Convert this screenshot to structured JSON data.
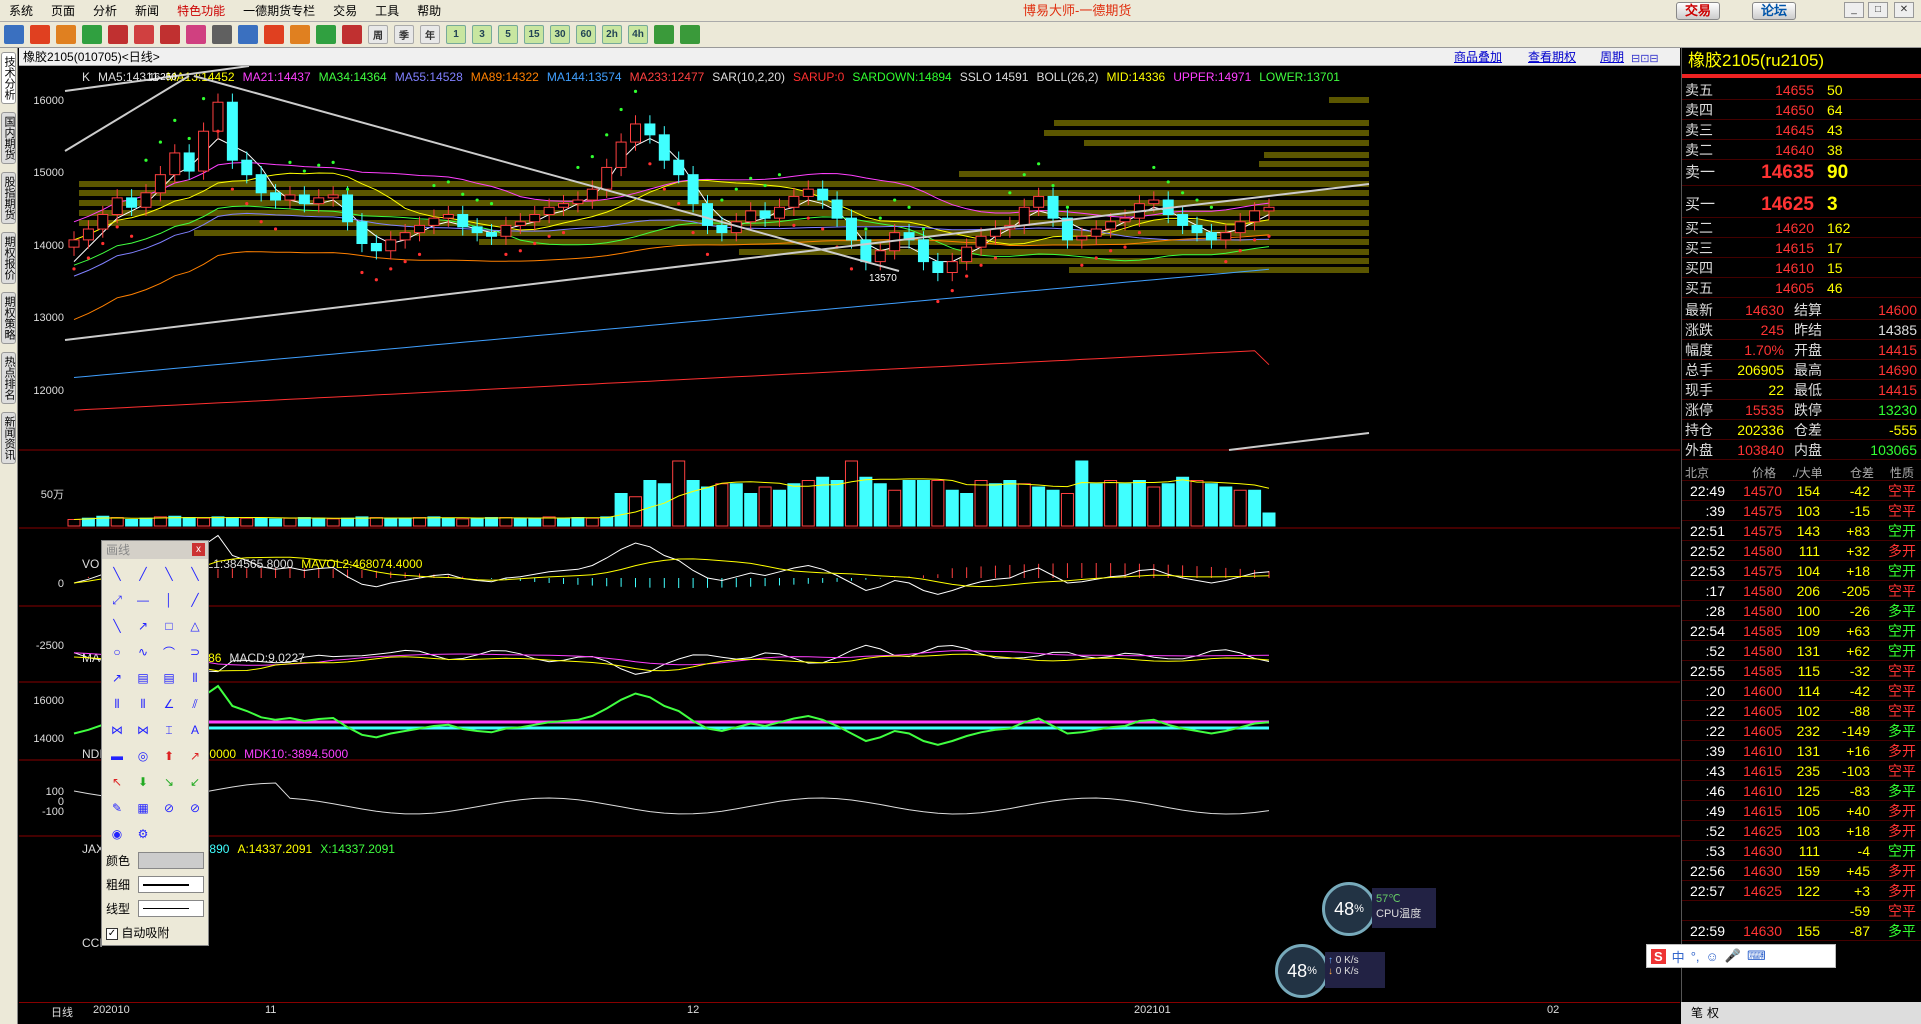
{
  "menu": {
    "items": [
      "系统",
      "页面",
      "分析",
      "新闻",
      "特色功能",
      "一德期货专栏",
      "交易",
      "工具",
      "帮助"
    ],
    "app_title": "博易大师-一德期货",
    "trade_label": "交易",
    "forum_label": "论坛"
  },
  "toolbar": {
    "text_buttons": [
      "周",
      "季",
      "年",
      "1",
      "3",
      "5",
      "15",
      "30",
      "60",
      "2h",
      "4h"
    ]
  },
  "left_tabs": [
    "技术分析",
    "国内期货",
    "股指期货",
    "期权报价",
    "期权策略",
    "热点排名",
    "新闻资讯"
  ],
  "title_bar": {
    "symbol": "橡胶2105(010705)<日线>",
    "links": [
      "商品叠加",
      "查看期权",
      "周期"
    ]
  },
  "main_chart": {
    "legend": [
      {
        "t": "K",
        "c": "#ddd"
      },
      {
        "t": "MA5:14311",
        "c": "#ddd"
      },
      {
        "t": "MA13:14452",
        "c": "#ffff00"
      },
      {
        "t": "MA21:14437",
        "c": "#ff40ff"
      },
      {
        "t": "MA34:14364",
        "c": "#40ff40"
      },
      {
        "t": "MA55:14528",
        "c": "#8080ff"
      },
      {
        "t": "MA89:14322",
        "c": "#ff8000"
      },
      {
        "t": "MA144:13574",
        "c": "#40a0ff"
      },
      {
        "t": "MA233:12477",
        "c": "#ff4040"
      },
      {
        "t": "SAR(10,2,20)",
        "c": "#ddd"
      },
      {
        "t": "SARUP:0",
        "c": "#ff3030"
      },
      {
        "t": "SARDOWN:14894",
        "c": "#30ff30"
      },
      {
        "t": "SSLO 14591",
        "c": "#ddd"
      },
      {
        "t": "BOLL(26,2)",
        "c": "#ddd"
      },
      {
        "t": "MID:14336",
        "c": "#ffff00"
      },
      {
        "t": "UPPER:14971",
        "c": "#ff40ff"
      },
      {
        "t": "LOWER:13701",
        "c": "#40ff40"
      }
    ],
    "y_ticks": [
      "16000",
      "15000",
      "14000",
      "13000",
      "12000"
    ],
    "hi_label": "16250",
    "lo_label": "13570"
  },
  "vol_panel": {
    "legend": [
      {
        "t": "VO",
        "c": "#ddd"
      },
      {
        "t": "6905.0000",
        "c": "#ddd"
      },
      {
        "t": "MAVOL1:384565.8000",
        "c": "#ddd"
      },
      {
        "t": "MAVOL2:468074.4000",
        "c": "#ffff00"
      }
    ],
    "y_tick": "50万"
  },
  "macd_panel": {
    "legend": [
      {
        "t": "MA",
        "c": "#ddd"
      },
      {
        "t": ".9772",
        "c": "#ddd"
      },
      {
        "t": "DEA:-12.4886",
        "c": "#ffff00"
      },
      {
        "t": "MACD:9.0227",
        "c": "#ddd"
      }
    ],
    "y_tick": "0"
  },
  "ndi_panel": {
    "legend": [
      {
        "t": "NDI",
        "c": "#ddd"
      },
      {
        "t": "000",
        "c": "#ddd"
      },
      {
        "t": "MDK5:-4096.0000",
        "c": "#ffff00"
      },
      {
        "t": "MDK10:-3894.5000",
        "c": "#ff40ff"
      }
    ],
    "y_tick": "-2500"
  },
  "jax_panel": {
    "legend": [
      {
        "t": "JAX",
        "c": "#ddd"
      },
      {
        "t": "1.3890",
        "c": "#ff40ff"
      },
      {
        "t": "J:14521.3890",
        "c": "#40ffff"
      },
      {
        "t": "A:14337.2091",
        "c": "#ffff00"
      },
      {
        "t": "X:14337.2091",
        "c": "#40ff40"
      }
    ],
    "y_ticks": [
      "16000",
      "14000"
    ]
  },
  "cci_panel": {
    "legend": [
      {
        "t": "CCI",
        "c": "#ddd"
      }
    ],
    "y_ticks": [
      "100",
      "0",
      "-100"
    ]
  },
  "date_axis": {
    "period": "日线",
    "labels": [
      "202010",
      "11",
      "12",
      "202101",
      "02"
    ]
  },
  "draw_panel": {
    "title": "画线",
    "close": "x",
    "color_label": "颜色",
    "width_label": "粗细",
    "style_label": "线型",
    "auto_label": "自动吸附"
  },
  "quote": {
    "name": "橡胶2105(ru2105)",
    "asks": [
      {
        "l": "卖五",
        "p": "14655",
        "v": "50"
      },
      {
        "l": "卖四",
        "p": "14650",
        "v": "64"
      },
      {
        "l": "卖三",
        "p": "14645",
        "v": "43"
      },
      {
        "l": "卖二",
        "p": "14640",
        "v": "38"
      },
      {
        "l": "卖一",
        "p": "14635",
        "v": "90"
      }
    ],
    "bids": [
      {
        "l": "买一",
        "p": "14625",
        "v": "3"
      },
      {
        "l": "买二",
        "p": "14620",
        "v": "162"
      },
      {
        "l": "买三",
        "p": "14615",
        "v": "17"
      },
      {
        "l": "买四",
        "p": "14610",
        "v": "15"
      },
      {
        "l": "买五",
        "p": "14605",
        "v": "46"
      }
    ],
    "stats": [
      {
        "a": "最新",
        "b": "14630",
        "bc": "#f33",
        "c": "结算",
        "d": "14600",
        "dc": "#f33"
      },
      {
        "a": "涨跌",
        "b": "245",
        "bc": "#f33",
        "c": "昨结",
        "d": "14385",
        "dc": "#ddd"
      },
      {
        "a": "幅度",
        "b": "1.70%",
        "bc": "#f33",
        "c": "开盘",
        "d": "14415",
        "dc": "#f33"
      },
      {
        "a": "总手",
        "b": "206905",
        "bc": "#ff0",
        "c": "最高",
        "d": "14690",
        "dc": "#f33"
      },
      {
        "a": "现手",
        "b": "22",
        "bc": "#ff0",
        "c": "最低",
        "d": "14415",
        "dc": "#f33"
      },
      {
        "a": "涨停",
        "b": "15535",
        "bc": "#f33",
        "c": "跌停",
        "d": "13230",
        "dc": "#3f3"
      },
      {
        "a": "持仓",
        "b": "202336",
        "bc": "#ff0",
        "c": "仓差",
        "d": "-555",
        "dc": "#ff0"
      },
      {
        "a": "外盘",
        "b": "103840",
        "bc": "#f33",
        "c": "内盘",
        "d": "103065",
        "dc": "#3f3"
      }
    ],
    "ticks_header": [
      "北京",
      "价格",
      "./大单",
      "仓差",
      "性质"
    ],
    "ticks": [
      {
        "t": "22:49",
        "p": "14570",
        "v": "154",
        "d": "-42",
        "n": "空平",
        "nc": "#f33"
      },
      {
        "t": ":39",
        "p": "14575",
        "v": "103",
        "d": "-15",
        "n": "空平",
        "nc": "#f33"
      },
      {
        "t": "22:51",
        "p": "14575",
        "v": "143",
        "d": "+83",
        "n": "空开",
        "nc": "#3f3"
      },
      {
        "t": "22:52",
        "p": "14580",
        "v": "111",
        "d": "+32",
        "n": "多开",
        "nc": "#f33"
      },
      {
        "t": "22:53",
        "p": "14575",
        "v": "104",
        "d": "+18",
        "n": "空开",
        "nc": "#3f3"
      },
      {
        "t": ":17",
        "p": "14580",
        "v": "206",
        "d": "-205",
        "n": "空平",
        "nc": "#f33"
      },
      {
        "t": ":28",
        "p": "14580",
        "v": "100",
        "d": "-26",
        "n": "多平",
        "nc": "#3f3"
      },
      {
        "t": "22:54",
        "p": "14585",
        "v": "109",
        "d": "+63",
        "n": "空开",
        "nc": "#3f3"
      },
      {
        "t": ":52",
        "p": "14580",
        "v": "131",
        "d": "+62",
        "n": "空开",
        "nc": "#3f3"
      },
      {
        "t": "22:55",
        "p": "14585",
        "v": "115",
        "d": "-32",
        "n": "空平",
        "nc": "#f33"
      },
      {
        "t": ":20",
        "p": "14600",
        "v": "114",
        "d": "-42",
        "n": "空平",
        "nc": "#f33"
      },
      {
        "t": ":22",
        "p": "14605",
        "v": "102",
        "d": "-88",
        "n": "空平",
        "nc": "#f33"
      },
      {
        "t": ":22",
        "p": "14605",
        "v": "232",
        "d": "-149",
        "n": "多平",
        "nc": "#3f3"
      },
      {
        "t": ":39",
        "p": "14610",
        "v": "131",
        "d": "+16",
        "n": "多开",
        "nc": "#f33"
      },
      {
        "t": ":43",
        "p": "14615",
        "v": "235",
        "d": "-103",
        "n": "空平",
        "nc": "#f33"
      },
      {
        "t": ":46",
        "p": "14610",
        "v": "125",
        "d": "-83",
        "n": "多平",
        "nc": "#3f3"
      },
      {
        "t": ":49",
        "p": "14615",
        "v": "105",
        "d": "+40",
        "n": "多开",
        "nc": "#f33"
      },
      {
        "t": ":52",
        "p": "14625",
        "v": "103",
        "d": "+18",
        "n": "多开",
        "nc": "#f33"
      },
      {
        "t": ":53",
        "p": "14630",
        "v": "111",
        "d": "-4",
        "n": "空开",
        "nc": "#3f3"
      },
      {
        "t": "22:56",
        "p": "14630",
        "v": "159",
        "d": "+45",
        "n": "多开",
        "nc": "#f33"
      },
      {
        "t": "22:57",
        "p": "14625",
        "v": "122",
        "d": "+3",
        "n": "多开",
        "nc": "#f33"
      },
      {
        "t": "",
        "p": "",
        "v": "",
        "d": "-59",
        "n": "空平",
        "nc": "#f33"
      },
      {
        "t": "22:59",
        "p": "14630",
        "v": "155",
        "d": "-87",
        "n": "多平",
        "nc": "#3f3"
      }
    ],
    "bottom_tabs": [
      "笔",
      "权"
    ]
  },
  "monitor": {
    "cpu_pct": "48",
    "pct_sign": "%",
    "temp": "57℃",
    "temp_label": "CPU温度",
    "net_pct": "48",
    "up": "0 K/s",
    "down": "0 K/s"
  },
  "ime": {
    "labels": [
      "中",
      "°,"
    ]
  },
  "chart_data": {
    "type": "candlestick",
    "x_labels": [
      "202010",
      "11",
      "12",
      "202101",
      "02"
    ],
    "ylim": [
      11300,
      16600
    ],
    "close": [
      14200,
      14350,
      14550,
      14780,
      14650,
      14850,
      15100,
      15400,
      15150,
      15700,
      16100,
      15300,
      15100,
      14850,
      14750,
      14820,
      14700,
      14780,
      14820,
      14450,
      14150,
      14050,
      14200,
      14300,
      14400,
      14500,
      14550,
      14380,
      14300,
      14250,
      14400,
      14450,
      14550,
      14650,
      14700,
      14750,
      14900,
      15200,
      15550,
      15800,
      15650,
      15300,
      15100,
      14700,
      14400,
      14300,
      14450,
      14600,
      14500,
      14650,
      14800,
      14900,
      14750,
      14500,
      14200,
      13900,
      14050,
      14300,
      14200,
      13900,
      13750,
      13900,
      14100,
      14250,
      14350,
      14400,
      14650,
      14800,
      14500,
      14200,
      14250,
      14350,
      14450,
      14500,
      14700,
      14750,
      14550,
      14400,
      14300,
      14200,
      14300,
      14450,
      14600,
      14650
    ],
    "ma5": [
      13900,
      14100,
      14300,
      14500,
      14600,
      14700,
      14900,
      15100,
      15200,
      15400,
      15600,
      15500,
      15400,
      15200,
      14900,
      14750,
      14700,
      14700,
      14750,
      14600,
      14400,
      14250,
      14150,
      14200,
      14300,
      14400,
      14450,
      14400,
      14350,
      14300,
      14350,
      14400,
      14450,
      14550,
      14600,
      14700,
      14800,
      15000,
      15300,
      15500,
      15600,
      15500,
      15300,
      15000,
      14700,
      14500,
      14400,
      14450,
      14500,
      14600,
      14650,
      14750,
      14700,
      14600,
      14400,
      14150,
      14050,
      14100,
      14100,
      14000,
      13900,
      13900,
      14000,
      14100,
      14250,
      14350,
      14500,
      14600,
      14550,
      14450,
      14350,
      14300,
      14350,
      14450,
      14550,
      14650,
      14600,
      14500,
      14400,
      14300,
      14300,
      14350,
      14450,
      14550
    ],
    "ma233": [
      11850,
      11860,
      11870,
      11880,
      11890,
      11900,
      11910,
      11920,
      11930,
      11940,
      11950,
      11960,
      11970,
      11980,
      11990,
      12000,
      12010,
      12020,
      12030,
      12040,
      12050,
      12060,
      12070,
      12080,
      12090,
      12100,
      12110,
      12120,
      12130,
      12140,
      12150,
      12160,
      12170,
      12180,
      12190,
      12200,
      12210,
      12220,
      12230,
      12240,
      12250,
      12260,
      12270,
      12280,
      12290,
      12300,
      12310,
      12320,
      12330,
      12340,
      12350,
      12360,
      12370,
      12380,
      12390,
      12400,
      12410,
      12420,
      12430,
      12440,
      12450,
      12460,
      12470,
      12480,
      12490,
      12500,
      12510,
      12520,
      12530,
      12540,
      12550,
      12560,
      12570,
      12580,
      12590,
      12600,
      12610,
      12620,
      12630,
      12640,
      12650,
      12660,
      12670,
      12477
    ],
    "volume": [
      0.1,
      0.12,
      0.15,
      0.13,
      0.1,
      0.12,
      0.14,
      0.15,
      0.13,
      0.12,
      0.14,
      0.13,
      0.12,
      0.12,
      0.11,
      0.12,
      0.13,
      0.12,
      0.11,
      0.12,
      0.14,
      0.13,
      0.12,
      0.12,
      0.13,
      0.14,
      0.12,
      0.11,
      0.12,
      0.13,
      0.13,
      0.12,
      0.12,
      0.14,
      0.12,
      0.13,
      0.12,
      0.14,
      0.5,
      0.45,
      0.7,
      0.65,
      1.0,
      0.7,
      0.6,
      0.65,
      0.65,
      0.5,
      0.6,
      0.55,
      0.65,
      0.7,
      0.75,
      0.7,
      1.0,
      0.75,
      0.65,
      0.55,
      0.7,
      0.7,
      0.7,
      0.55,
      0.5,
      0.7,
      0.65,
      0.7,
      0.65,
      0.6,
      0.55,
      0.5,
      1.0,
      0.65,
      0.7,
      0.65,
      0.7,
      0.6,
      0.65,
      0.75,
      0.7,
      0.65,
      0.6,
      0.55,
      0.55,
      0.2
    ]
  }
}
